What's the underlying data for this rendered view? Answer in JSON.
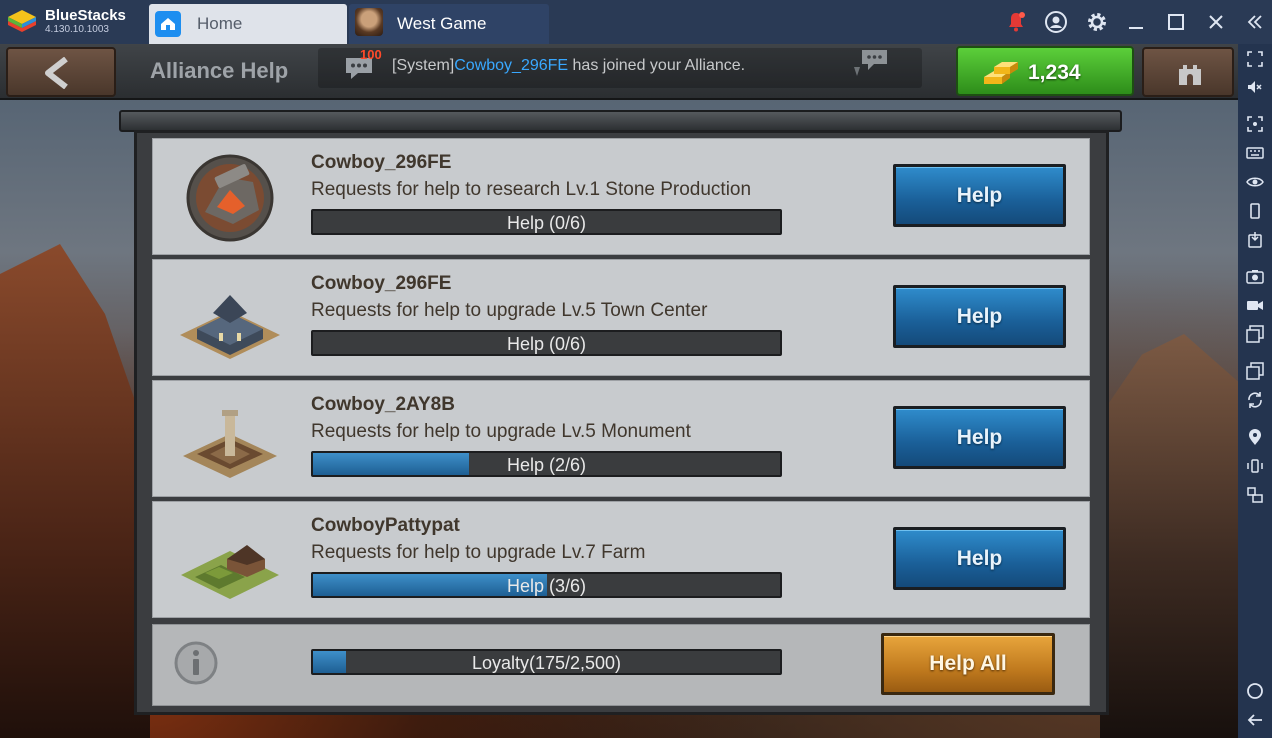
{
  "bluestacks": {
    "app_name": "BlueStacks",
    "version": "4.130.10.1003",
    "tabs": [
      {
        "label": "Home",
        "icon": "home-icon"
      },
      {
        "label": "West Game",
        "icon": "west-game-icon"
      }
    ],
    "toolbar_icons": [
      "notification-bell-icon",
      "account-icon",
      "settings-gear-icon",
      "minimize-icon",
      "maximize-icon",
      "close-icon",
      "collapse-sidebar-icon"
    ],
    "sidebar_icons": [
      "fullscreen-icon",
      "volume-mute-icon",
      "lock-cursor-icon",
      "keyboard-controls-icon",
      "eye-icon",
      "portrait-rotate-icon",
      "install-apk-icon",
      "screenshot-camera-icon",
      "record-video-icon",
      "media-folder-icon",
      "multi-instance-icon",
      "sync-icon",
      "location-icon",
      "shake-icon",
      "more-icon",
      "home-circle-icon",
      "back-arrow-icon"
    ]
  },
  "header": {
    "title": "Alliance Help",
    "chat": {
      "count": "100",
      "prefix": "[System]",
      "name": "Cowboy_296FE",
      "text": " has joined your Alliance."
    },
    "gold": "1,234"
  },
  "requests": [
    {
      "user": "Cowboy_296FE",
      "description": "Requests for help to research Lv.1 Stone Production",
      "progress_text": "Help (0/6)",
      "progress": 0,
      "button": "Help",
      "icon": "stone-production-icon"
    },
    {
      "user": "Cowboy_296FE",
      "description": "Requests for help to upgrade Lv.5 Town Center",
      "progress_text": "Help (0/6)",
      "progress": 0,
      "button": "Help",
      "icon": "town-center-icon"
    },
    {
      "user": "Cowboy_2AY8B",
      "description": "Requests for help to upgrade Lv.5 Monument",
      "progress_text": "Help (2/6)",
      "progress": 0.333,
      "button": "Help",
      "icon": "monument-icon"
    },
    {
      "user": "CowboyPattypat",
      "description": "Requests for help to upgrade Lv.7 Farm",
      "progress_text": "Help (3/6)",
      "progress": 0.5,
      "button": "Help",
      "icon": "farm-icon"
    }
  ],
  "footer": {
    "loyalty_text": "Loyalty(175/2,500)",
    "loyalty_progress": 0.07,
    "help_all": "Help All"
  },
  "colors": {
    "titlebar": "#2a3a55",
    "help_button": "#1a5f98",
    "help_all_button": "#c07a1e",
    "gold_button": "#2e8d1a",
    "chat_name": "#39a8ff"
  }
}
